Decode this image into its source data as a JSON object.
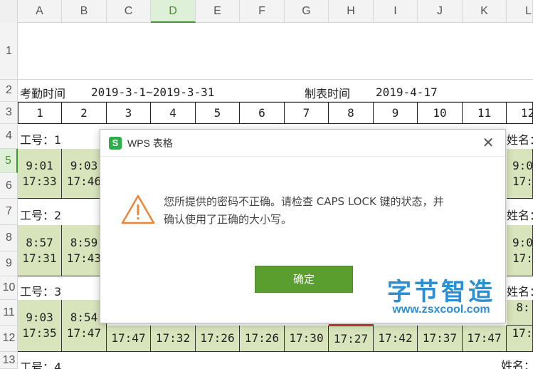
{
  "columns": [
    "A",
    "B",
    "C",
    "D",
    "E",
    "F",
    "G",
    "H",
    "I",
    "J",
    "K",
    "L"
  ],
  "active_column": "D",
  "rows": [
    "1",
    "2",
    "3",
    "4",
    "5",
    "6",
    "7",
    "8",
    "9",
    "10",
    "11",
    "12",
    "13"
  ],
  "active_row": "5",
  "sheet": {
    "r2_label": "考勤时间",
    "r2_range": "2019-3-1~2019-3-31",
    "r2_made_label": "制表时间",
    "r2_made_date": "2019-4-17",
    "day_numbers": [
      "1",
      "2",
      "3",
      "4",
      "5",
      "6",
      "7",
      "8",
      "9",
      "10",
      "11",
      "12"
    ],
    "emp1_label": "工号：1",
    "emp2_label": "工号：2",
    "emp3_label": "工号：3",
    "emp4_label": "工号：4",
    "name_label": "姓名：",
    "emp1_times": [
      [
        "9:01",
        "17:33"
      ],
      [
        "9:03",
        "17:46"
      ]
    ],
    "emp1_right": [
      "9:0",
      "17:"
    ],
    "emp2_times": [
      [
        "8:57",
        "17:31"
      ],
      [
        "8:59",
        "17:43"
      ]
    ],
    "emp2_right": [
      "9:0",
      "17:"
    ],
    "emp3_times": [
      [
        "9:03",
        "17:35"
      ],
      [
        "8:54",
        "17:47"
      ]
    ],
    "emp3_row12": [
      "17:47",
      "17:32",
      "17:26",
      "17:26",
      "17:30",
      "17:27",
      "17:42",
      "17:37",
      "17:47",
      "17:"
    ],
    "emp3_right_top": "8:"
  },
  "dialog": {
    "title": "WPS 表格",
    "app_icon_letter": "S",
    "close_symbol": "✕",
    "message_line1": "您所提供的密码不正确。请检查 CAPS LOCK 键的状态，并",
    "message_line2": "确认使用了正确的大小写。",
    "ok_label": "确定"
  },
  "watermark": {
    "title": "字节智造",
    "url": "www.zsxcool.com"
  },
  "colors": {
    "accent_green": "#5a9e2f",
    "cell_green": "#d8e4bc",
    "warning_orange": "#e8863a",
    "watermark_blue": "#2b8fd4"
  }
}
